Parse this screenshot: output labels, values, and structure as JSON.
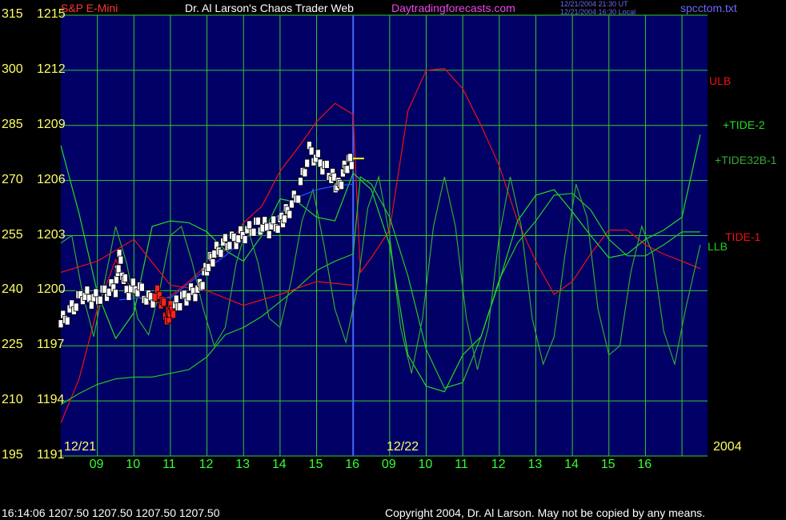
{
  "header": {
    "instrument": "S&P E-Mini",
    "title": "Dr. Al Larson's Chaos Trader Web",
    "site": "Daytradingforecasts.com",
    "time_ut": "12/21/2004 21:30 UT",
    "time_local": "12/21/2004 16:30 Local",
    "file": "spcctom.txt"
  },
  "footer": {
    "quote": "16:14:06  1207.50 1207.50 1207.50 1207.50",
    "copyright": "Copyright 2004, Dr. Al Larson. May not be copied by any means."
  },
  "colors": {
    "background": "#000066",
    "grid": "#33cc33",
    "price_bar": "#ffffff",
    "price_outline": "#000000",
    "price_recent": "#ff2222",
    "forecast_line": "#ffff00",
    "ulb": "#ee1111",
    "llb": "#22cc22",
    "tide2": "#22dd22",
    "tide32b": "#33aa33",
    "tide1": "#ee1111",
    "mid_band": "#2255ff",
    "date_divider": "#4466ff",
    "axis_yellow": "#ffff66",
    "hour_green": "#33ff33"
  },
  "chart_data": {
    "type": "line",
    "title": "Dr. Al Larson's Chaos Trader Web",
    "y_axis_left_outer": {
      "ticks": [
        195,
        210,
        225,
        240,
        255,
        270,
        285,
        300,
        315
      ],
      "range": [
        195,
        315
      ]
    },
    "y_axis_left_inner": {
      "ticks": [
        "1191",
        "1194",
        "1197",
        "1200",
        "1203",
        "1206",
        "1209",
        "1212",
        "1215"
      ],
      "range": [
        1191,
        1215
      ]
    },
    "x_hours_day1": [
      "09",
      "10",
      "11",
      "12",
      "13",
      "14",
      "15",
      "16"
    ],
    "x_hours_day2": [
      "09",
      "10",
      "11",
      "12",
      "13",
      "14",
      "15",
      "16"
    ],
    "date_labels": [
      "12/21",
      "12/22",
      "2004"
    ],
    "x_range_hours": [
      0,
      16
    ],
    "grid": true,
    "series": [
      {
        "name": "ULB",
        "points": [
          [
            0,
            1192.8
          ],
          [
            0.5,
            1195.2
          ],
          [
            1,
            1199.0
          ],
          [
            1.5,
            1201.7
          ],
          [
            2,
            1199.8
          ],
          [
            2.5,
            1199.2
          ],
          [
            3,
            1199.7
          ],
          [
            3.5,
            1200.5
          ],
          [
            4,
            1201.4
          ],
          [
            4.5,
            1202.2
          ],
          [
            5,
            1203.7
          ],
          [
            5.5,
            1204.6
          ],
          [
            6,
            1206.5
          ],
          [
            6.5,
            1207.8
          ],
          [
            7,
            1209.2
          ],
          [
            7.5,
            1210.2
          ],
          [
            8,
            1209.6
          ],
          [
            8.2,
            1201.0
          ],
          [
            8.5,
            1201.8
          ],
          [
            9,
            1203.3
          ],
          [
            9.5,
            1209.8
          ],
          [
            10,
            1212.0
          ],
          [
            10.5,
            1212.1
          ],
          [
            11,
            1211.0
          ],
          [
            11.5,
            1209.0
          ],
          [
            12,
            1206.8
          ],
          [
            12.5,
            1203.8
          ],
          [
            13,
            1201.6
          ],
          [
            13.5,
            1199.8
          ],
          [
            14,
            1200.5
          ],
          [
            14.5,
            1202.0
          ],
          [
            15,
            1203.3
          ],
          [
            15.5,
            1203.3
          ],
          [
            16,
            1202.5
          ],
          [
            16.5,
            1202.0
          ],
          [
            17,
            1201.6
          ],
          [
            17.5,
            1201.2
          ]
        ]
      },
      {
        "name": "LLB",
        "points": [
          [
            0,
            1193.8
          ],
          [
            0.5,
            1194.4
          ],
          [
            1,
            1194.9
          ],
          [
            1.5,
            1195.2
          ],
          [
            2,
            1195.3
          ],
          [
            2.5,
            1195.3
          ],
          [
            3,
            1195.5
          ],
          [
            3.5,
            1195.7
          ],
          [
            4,
            1196.4
          ],
          [
            4.5,
            1197.6
          ],
          [
            5,
            1198.0
          ],
          [
            5.5,
            1198.6
          ],
          [
            6,
            1199.4
          ],
          [
            6.5,
            1200.2
          ],
          [
            7,
            1201.1
          ],
          [
            7.5,
            1201.6
          ],
          [
            8,
            1202.0
          ],
          [
            8.2,
            1206.2
          ],
          [
            8.5,
            1205.8
          ],
          [
            9,
            1204.0
          ],
          [
            9.5,
            1200.8
          ],
          [
            10,
            1196.8
          ],
          [
            10.5,
            1194.7
          ],
          [
            11,
            1195.0
          ],
          [
            11.5,
            1197.5
          ],
          [
            12,
            1200.6
          ],
          [
            12.5,
            1202.6
          ],
          [
            13,
            1203.8
          ],
          [
            13.5,
            1205.2
          ],
          [
            14,
            1205.3
          ],
          [
            14.5,
            1204.4
          ],
          [
            15,
            1202.8
          ],
          [
            15.5,
            1201.9
          ],
          [
            16,
            1201.9
          ],
          [
            16.5,
            1202.5
          ],
          [
            17,
            1203.2
          ],
          [
            17.5,
            1203.2
          ]
        ]
      },
      {
        "name": "+TIDE-2",
        "points": [
          [
            0,
            1207.9
          ],
          [
            0.5,
            1204.2
          ],
          [
            1,
            1199.9
          ],
          [
            1.5,
            1197.4
          ],
          [
            2,
            1198.8
          ],
          [
            2.5,
            1203.5
          ],
          [
            3,
            1203.8
          ],
          [
            3.5,
            1203.7
          ],
          [
            4,
            1203.2
          ],
          [
            4.5,
            1202.2
          ],
          [
            5,
            1201.6
          ],
          [
            5.5,
            1203.0
          ],
          [
            6,
            1205.0
          ],
          [
            6.5,
            1204.8
          ],
          [
            7,
            1204.0
          ],
          [
            7.5,
            1203.8
          ],
          [
            8,
            1206.4
          ],
          [
            8.5,
            1205.5
          ],
          [
            9,
            1202.5
          ],
          [
            9.5,
            1196.5
          ],
          [
            10,
            1194.8
          ],
          [
            10.5,
            1194.5
          ],
          [
            11,
            1196.5
          ],
          [
            11.5,
            1197.5
          ],
          [
            12,
            1200.5
          ],
          [
            12.5,
            1203.8
          ],
          [
            13,
            1205.2
          ],
          [
            13.5,
            1205.5
          ],
          [
            14,
            1204.3
          ],
          [
            14.5,
            1203.0
          ],
          [
            15,
            1201.8
          ],
          [
            15.5,
            1202.0
          ],
          [
            16,
            1202.8
          ],
          [
            16.5,
            1203.3
          ],
          [
            17,
            1204.0
          ],
          [
            17.5,
            1208.5
          ]
        ]
      },
      {
        "name": "+TIDE32B-1",
        "points": [
          [
            0,
            1202.6
          ],
          [
            0.3,
            1203.0
          ],
          [
            0.6,
            1199.8
          ],
          [
            0.9,
            1197.5
          ],
          [
            1.2,
            1200.5
          ],
          [
            1.5,
            1203.5
          ],
          [
            1.8,
            1201.5
          ],
          [
            2.1,
            1198.5
          ],
          [
            2.4,
            1197.6
          ],
          [
            2.7,
            1200.0
          ],
          [
            3.0,
            1203.0
          ],
          [
            3.3,
            1203.5
          ],
          [
            3.6,
            1201.5
          ],
          [
            3.9,
            1199.0
          ],
          [
            4.2,
            1197.0
          ],
          [
            4.5,
            1198.0
          ],
          [
            4.8,
            1201.5
          ],
          [
            5.1,
            1203.5
          ],
          [
            5.4,
            1201.5
          ],
          [
            5.7,
            1198.5
          ],
          [
            6.0,
            1198.0
          ],
          [
            6.3,
            1200.5
          ],
          [
            6.6,
            1203.8
          ],
          [
            6.9,
            1205.5
          ],
          [
            7.2,
            1202.5
          ],
          [
            7.5,
            1199.0
          ],
          [
            7.8,
            1197.2
          ],
          [
            8.1,
            1200.0
          ],
          [
            8.4,
            1204.5
          ],
          [
            8.7,
            1206.2
          ],
          [
            9.0,
            1203.0
          ],
          [
            9.3,
            1198.0
          ],
          [
            9.6,
            1195.5
          ],
          [
            9.9,
            1198.5
          ],
          [
            10.2,
            1203.5
          ],
          [
            10.5,
            1206.2
          ],
          [
            10.8,
            1203.5
          ],
          [
            11.1,
            1198.5
          ],
          [
            11.4,
            1195.7
          ],
          [
            11.7,
            1198.0
          ],
          [
            12.0,
            1203.0
          ],
          [
            12.3,
            1206.2
          ],
          [
            12.6,
            1203.5
          ],
          [
            12.9,
            1198.5
          ],
          [
            13.2,
            1196.0
          ],
          [
            13.5,
            1197.5
          ],
          [
            13.8,
            1202.0
          ],
          [
            14.1,
            1205.8
          ],
          [
            14.4,
            1204.0
          ],
          [
            14.7,
            1199.0
          ],
          [
            15.0,
            1196.5
          ],
          [
            15.3,
            1197.0
          ],
          [
            15.6,
            1201.0
          ],
          [
            15.9,
            1203.5
          ],
          [
            16.2,
            1202.0
          ],
          [
            16.5,
            1197.8
          ],
          [
            16.8,
            1196.0
          ],
          [
            17.1,
            1199.0
          ],
          [
            17.5,
            1202.5
          ]
        ]
      },
      {
        "name": "TIDE-1",
        "points": [
          [
            0,
            1201.0
          ],
          [
            1,
            1201.6
          ],
          [
            2,
            1202.8
          ],
          [
            3,
            1200.3
          ],
          [
            4,
            1200.0
          ],
          [
            5,
            1199.2
          ],
          [
            6,
            1199.8
          ],
          [
            7,
            1200.5
          ],
          [
            8,
            1200.3
          ]
        ]
      },
      {
        "name": "mid",
        "points": [
          [
            1.6,
            1199.5
          ],
          [
            2.5,
            1199.7
          ],
          [
            3.0,
            1199.6
          ],
          [
            3.5,
            1200.4
          ],
          [
            4.0,
            1201.2
          ],
          [
            4.5,
            1201.9
          ],
          [
            5.0,
            1202.8
          ],
          [
            5.5,
            1203.3
          ],
          [
            6.0,
            1204.2
          ],
          [
            6.5,
            1205.1
          ],
          [
            7.0,
            1205.5
          ],
          [
            7.5,
            1205.7
          ],
          [
            8.0,
            1205.8
          ]
        ]
      },
      {
        "name": "price",
        "points": [
          [
            0,
            1198.2
          ],
          [
            0.3,
            1199.0
          ],
          [
            0.6,
            1199.8
          ],
          [
            0.9,
            1199.5
          ],
          [
            1.2,
            1199.9
          ],
          [
            1.5,
            1200.2
          ],
          [
            1.6,
            1201.8
          ],
          [
            1.8,
            1200.0
          ],
          [
            2.1,
            1200.2
          ],
          [
            2.4,
            1199.5
          ],
          [
            2.7,
            1199.8
          ],
          [
            2.9,
            1198.6
          ],
          [
            3.0,
            1198.9
          ],
          [
            3.2,
            1199.3
          ],
          [
            3.5,
            1199.8
          ],
          [
            3.8,
            1200.1
          ],
          [
            4.0,
            1201.3
          ],
          [
            4.2,
            1202.0
          ],
          [
            4.5,
            1202.6
          ],
          [
            4.8,
            1202.8
          ],
          [
            5.1,
            1203.2
          ],
          [
            5.4,
            1203.6
          ],
          [
            5.7,
            1203.4
          ],
          [
            6.0,
            1203.7
          ],
          [
            6.2,
            1204.3
          ],
          [
            6.5,
            1205.3
          ],
          [
            6.8,
            1207.6
          ],
          [
            7.1,
            1207.0
          ],
          [
            7.4,
            1206.3
          ],
          [
            7.6,
            1205.6
          ],
          [
            7.8,
            1206.8
          ],
          [
            8.0,
            1207.2
          ]
        ]
      },
      {
        "name": "forecast",
        "points": [
          [
            7.8,
            1207.2
          ],
          [
            8.3,
            1207.2
          ]
        ]
      }
    ],
    "series_labels": [
      "ULB",
      "+TIDE-2",
      "+TIDE32B-1",
      "TIDE-1",
      "LLB"
    ],
    "annotations": [
      "12/21",
      "12/22",
      "2004"
    ]
  }
}
